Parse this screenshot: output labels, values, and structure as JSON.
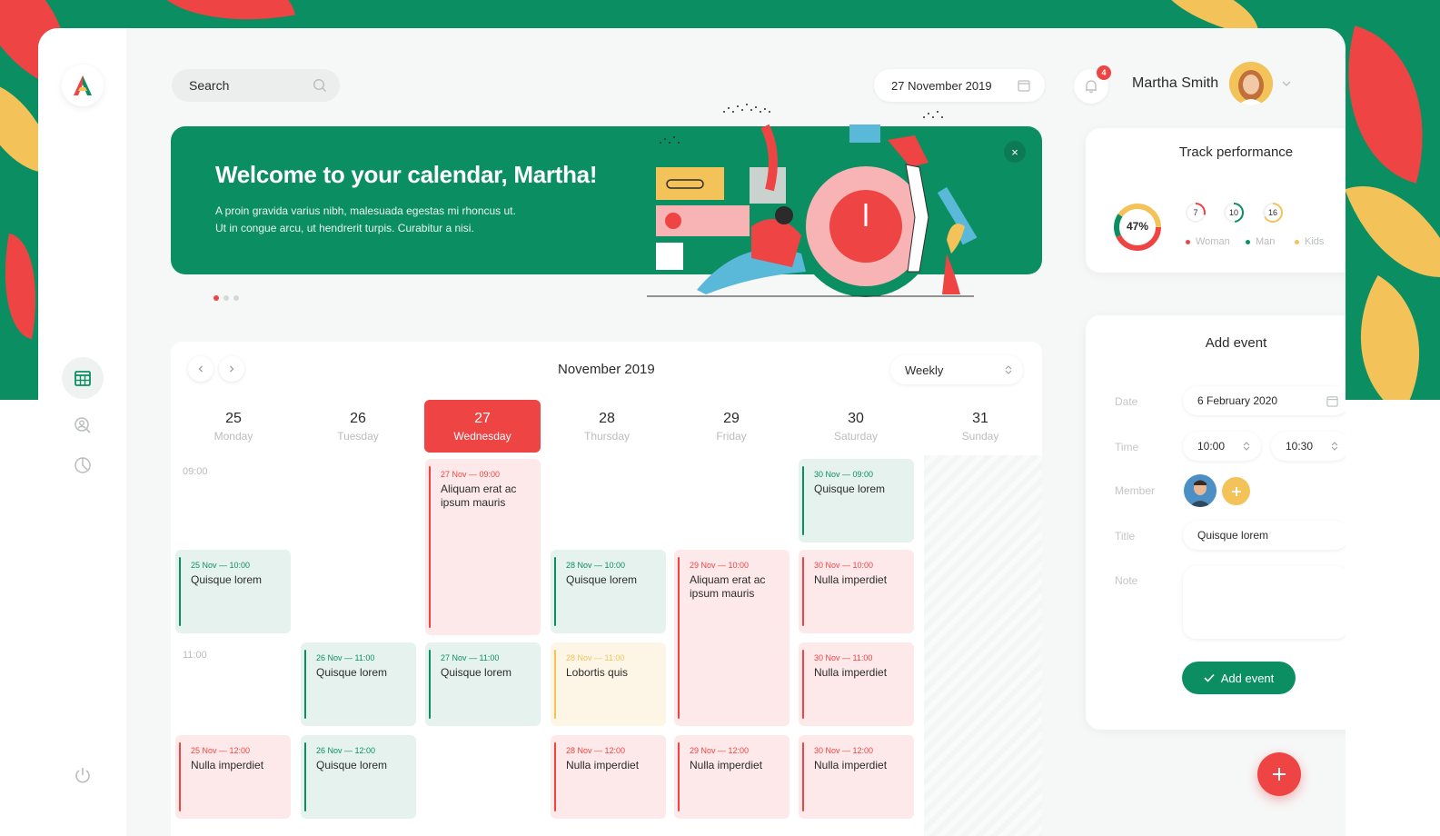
{
  "search": {
    "placeholder": "Search"
  },
  "header": {
    "date": "27 November 2019",
    "notification_count": "4",
    "user_name": "Martha Smith"
  },
  "banner": {
    "title": "Welcome to your calendar, Martha!",
    "line1": "A proin gravida varius nibh, malesuada egestas mi rhoncus ut.",
    "line2": "Ut in congue arcu, ut hendrerit turpis. Curabitur a nisi.",
    "close": "×"
  },
  "calendar": {
    "month": "November 2019",
    "view": "Weekly",
    "days": [
      {
        "num": "25",
        "name": "Monday"
      },
      {
        "num": "26",
        "name": "Tuesday"
      },
      {
        "num": "27",
        "name": "Wednesday"
      },
      {
        "num": "28",
        "name": "Thursday"
      },
      {
        "num": "29",
        "name": "Friday"
      },
      {
        "num": "30",
        "name": "Saturday"
      },
      {
        "num": "31",
        "name": "Sunday"
      }
    ],
    "times": [
      "09:00",
      "11:00"
    ],
    "events": [
      {
        "time": "27 Nov — 09:00",
        "title": "Aliquam erat ac ipsum mauris",
        "color": "red"
      },
      {
        "time": "30 Nov — 09:00",
        "title": "Quisque lorem",
        "color": "green"
      },
      {
        "time": "25 Nov — 10:00",
        "title": "Quisque lorem",
        "color": "green"
      },
      {
        "time": "28 Nov — 10:00",
        "title": "Quisque lorem",
        "color": "green"
      },
      {
        "time": "29 Nov — 10:00",
        "title": "Aliquam erat ac ipsum mauris",
        "color": "red"
      },
      {
        "time": "30 Nov — 10:00",
        "title": "Nulla imperdiet",
        "color": "red"
      },
      {
        "time": "26 Nov — 11:00",
        "title": "Quisque lorem",
        "color": "green"
      },
      {
        "time": "27 Nov — 11:00",
        "title": "Quisque lorem",
        "color": "green"
      },
      {
        "time": "28 Nov — 11:00",
        "title": "Lobortis quis",
        "color": "yellow"
      },
      {
        "time": "30 Nov — 11:00",
        "title": "Nulla imperdiet",
        "color": "red"
      },
      {
        "time": "25 Nov — 12:00",
        "title": "Nulla imperdiet",
        "color": "red"
      },
      {
        "time": "26 Nov — 12:00",
        "title": "Quisque lorem",
        "color": "green"
      },
      {
        "time": "28 Nov — 12:00",
        "title": "Nulla imperdiet",
        "color": "red"
      },
      {
        "time": "29 Nov — 12:00",
        "title": "Nulla imperdiet",
        "color": "red"
      },
      {
        "time": "30 Nov — 12:00",
        "title": "Nulla imperdiet",
        "color": "red"
      }
    ]
  },
  "performance": {
    "title": "Track performance",
    "total": "47%",
    "total_fraction": 0.47,
    "segments": [
      {
        "label": "Woman",
        "value": "7",
        "color": "#ee4444"
      },
      {
        "label": "Man",
        "value": "10",
        "color": "#0b8f62"
      },
      {
        "label": "Kids",
        "value": "16",
        "color": "#f3c35a"
      }
    ]
  },
  "add_event": {
    "title": "Add event",
    "date_label": "Date",
    "date_value": "6 February 2020",
    "time_label": "Time",
    "time_from": "10:00",
    "time_to": "10:30",
    "member_label": "Member",
    "title_label": "Title",
    "title_value": "Quisque lorem",
    "note_label": "Note",
    "button": "Add event"
  },
  "colors": {
    "brand_green": "#0b8f62",
    "accent_red": "#ee4444",
    "accent_yellow": "#f3c35a"
  },
  "icons": [
    "logo-a-icon",
    "search-icon",
    "calendar-icon",
    "bell-icon",
    "chevron-down-icon",
    "calendar-grid-icon",
    "user-search-icon",
    "clock-icon",
    "power-icon",
    "chevron-left-icon",
    "chevron-right-icon",
    "select-arrows-icon",
    "check-icon",
    "plus-icon",
    "close-icon"
  ]
}
